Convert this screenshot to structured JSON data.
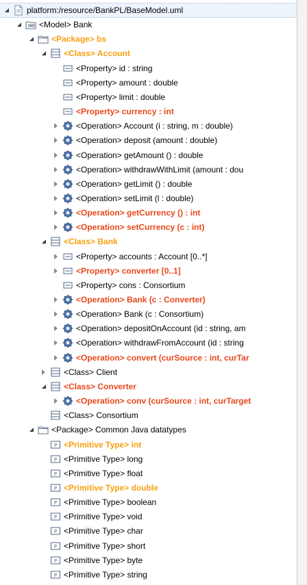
{
  "tree": {
    "rows": [
      {
        "depth": 0,
        "twisty": "open",
        "icon": "resource",
        "label": "platform:/resource/BankPL/BaseModel.uml",
        "style": "normal"
      },
      {
        "depth": 1,
        "twisty": "open",
        "icon": "model",
        "label": "<Model> Bank",
        "style": "normal"
      },
      {
        "depth": 2,
        "twisty": "open",
        "icon": "package",
        "label": "<Package> bs",
        "style": "orange"
      },
      {
        "depth": 3,
        "twisty": "open",
        "icon": "class",
        "label": "<Class> Account",
        "style": "orange"
      },
      {
        "depth": 4,
        "twisty": "none",
        "icon": "property",
        "label": "<Property> id : string",
        "style": "normal"
      },
      {
        "depth": 4,
        "twisty": "none",
        "icon": "property",
        "label": "<Property> amount : double",
        "style": "normal"
      },
      {
        "depth": 4,
        "twisty": "none",
        "icon": "property",
        "label": "<Property> limit : double",
        "style": "normal"
      },
      {
        "depth": 4,
        "twisty": "none",
        "icon": "property",
        "label": "<Property> currency : int",
        "style": "red"
      },
      {
        "depth": 4,
        "twisty": "closed",
        "icon": "operation",
        "label": "<Operation> Account (i : string, m : double)",
        "style": "normal"
      },
      {
        "depth": 4,
        "twisty": "closed",
        "icon": "operation",
        "label": "<Operation> deposit (amount : double)",
        "style": "normal"
      },
      {
        "depth": 4,
        "twisty": "closed",
        "icon": "operation",
        "label": "<Operation> getAmount () : double",
        "style": "normal"
      },
      {
        "depth": 4,
        "twisty": "closed",
        "icon": "operation",
        "label": "<Operation> withdrawWithLimit (amount : dou",
        "style": "normal"
      },
      {
        "depth": 4,
        "twisty": "closed",
        "icon": "operation",
        "label": "<Operation> getLimit () : double",
        "style": "normal"
      },
      {
        "depth": 4,
        "twisty": "closed",
        "icon": "operation",
        "label": "<Operation> setLimit (l : double)",
        "style": "normal"
      },
      {
        "depth": 4,
        "twisty": "closed",
        "icon": "operation",
        "label": "<Operation> getCurrency () : int",
        "style": "red"
      },
      {
        "depth": 4,
        "twisty": "closed",
        "icon": "operation",
        "label": "<Operation> setCurrency (c : int)",
        "style": "red"
      },
      {
        "depth": 3,
        "twisty": "open",
        "icon": "class",
        "label": "<Class> Bank",
        "style": "orange"
      },
      {
        "depth": 4,
        "twisty": "closed",
        "icon": "property",
        "label": "<Property> accounts : Account [0..*]",
        "style": "normal"
      },
      {
        "depth": 4,
        "twisty": "closed",
        "icon": "property",
        "label": "<Property> converter [0..1]",
        "style": "red"
      },
      {
        "depth": 4,
        "twisty": "none",
        "icon": "property",
        "label": "<Property> cons : Consortium",
        "style": "normal"
      },
      {
        "depth": 4,
        "twisty": "closed",
        "icon": "operation",
        "label": "<Operation> Bank (c : Converter)",
        "style": "red"
      },
      {
        "depth": 4,
        "twisty": "closed",
        "icon": "operation",
        "label": "<Operation> Bank (c : Consortium)",
        "style": "normal"
      },
      {
        "depth": 4,
        "twisty": "closed",
        "icon": "operation",
        "label": "<Operation> depositOnAccount (id : string, am",
        "style": "normal"
      },
      {
        "depth": 4,
        "twisty": "closed",
        "icon": "operation",
        "label": "<Operation> withdrawFromAccount (id : string",
        "style": "normal"
      },
      {
        "depth": 4,
        "twisty": "closed",
        "icon": "operation",
        "label": "<Operation> convert (curSource : int, curTar",
        "style": "red"
      },
      {
        "depth": 3,
        "twisty": "closed",
        "icon": "class",
        "label": "<Class> Client",
        "style": "normal"
      },
      {
        "depth": 3,
        "twisty": "open",
        "icon": "class",
        "label": "<Class> Converter",
        "style": "red"
      },
      {
        "depth": 4,
        "twisty": "closed",
        "icon": "operation",
        "label": "<Operation> conv (curSource : int, curTarget",
        "style": "red"
      },
      {
        "depth": 3,
        "twisty": "none",
        "icon": "class",
        "label": "<Class> Consortium",
        "style": "normal"
      },
      {
        "depth": 2,
        "twisty": "open",
        "icon": "package",
        "label": "<Package> Common Java datatypes",
        "style": "normal"
      },
      {
        "depth": 3,
        "twisty": "none",
        "icon": "primitive",
        "label": "<Primitive Type> int",
        "style": "orange"
      },
      {
        "depth": 3,
        "twisty": "none",
        "icon": "primitive",
        "label": "<Primitive Type> long",
        "style": "normal"
      },
      {
        "depth": 3,
        "twisty": "none",
        "icon": "primitive",
        "label": "<Primitive Type> float",
        "style": "normal"
      },
      {
        "depth": 3,
        "twisty": "none",
        "icon": "primitive",
        "label": "<Primitive Type> double",
        "style": "orange"
      },
      {
        "depth": 3,
        "twisty": "none",
        "icon": "primitive",
        "label": "<Primitive Type> boolean",
        "style": "normal"
      },
      {
        "depth": 3,
        "twisty": "none",
        "icon": "primitive",
        "label": "<Primitive Type> void",
        "style": "normal"
      },
      {
        "depth": 3,
        "twisty": "none",
        "icon": "primitive",
        "label": "<Primitive Type> char",
        "style": "normal"
      },
      {
        "depth": 3,
        "twisty": "none",
        "icon": "primitive",
        "label": "<Primitive Type> short",
        "style": "normal"
      },
      {
        "depth": 3,
        "twisty": "none",
        "icon": "primitive",
        "label": "<Primitive Type> byte",
        "style": "normal"
      },
      {
        "depth": 3,
        "twisty": "none",
        "icon": "primitive",
        "label": "<Primitive Type> string",
        "style": "normal"
      }
    ]
  },
  "colors": {
    "added": "#f5a012",
    "changed": "#e8471a",
    "normal": "#000000"
  }
}
